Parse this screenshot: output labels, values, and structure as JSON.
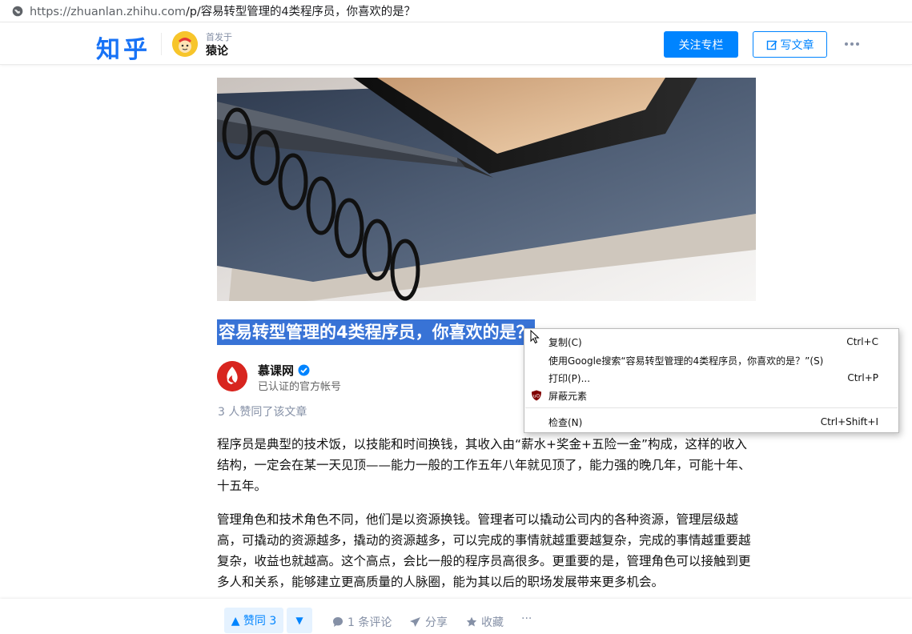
{
  "browser": {
    "url_host": "https://zhuanlan.zhihu.com",
    "url_path": "/p/容易转型管理的4类程序员，你喜欢的是？"
  },
  "header": {
    "logo": "知乎",
    "published_in": "首发于",
    "column_name": "猿论",
    "follow_label": "关注专栏",
    "write_label": "写文章"
  },
  "article": {
    "title": "容易转型管理的4类程序员，你喜欢的是？",
    "author_name": "慕课网",
    "author_desc": "已认证的官方帐号",
    "agree_summary": "3 人赞同了该文章",
    "paragraphs": [
      "程序员是典型的技术饭，以技能和时间换钱，其收入由“薪水+奖金+五险一金”构成，这样的收入结构，一定会在某一天见顶——能力一般的工作五年八年就见顶了，能力强的晚几年，可能十年、十五年。",
      "管理角色和技术角色不同，他们是以资源换钱。管理者可以撬动公司内的各种资源，管理层级越高，可撬动的资源越多，撬动的资源越多，可以完成的事情就越重要越复杂，完成的事情越重要越复杂，收益也就越高。这个高点，会比一般的程序员高很多。更重要的是，管理角色可以接触到更多人和关系，能够建立更高质量的人脉圈，能为其以后的职场发展带来更多机会。"
    ]
  },
  "actions": {
    "vote_up": "▲ 赞同 3",
    "vote_down": "▼",
    "comment": "1 条评论",
    "share": "分享",
    "favorite": "收藏",
    "more": "···"
  },
  "context_menu": {
    "items": [
      {
        "label": "复制(C)",
        "shortcut": "Ctrl+C"
      },
      {
        "label": "使用Google搜索“容易转型管理的4类程序员，你喜欢的是？”(S)",
        "shortcut": ""
      },
      {
        "label": "打印(P)...",
        "shortcut": "Ctrl+P"
      },
      {
        "label": "屏蔽元素",
        "shortcut": ""
      },
      {
        "label": "检查(N)",
        "shortcut": "Ctrl+Shift+I"
      }
    ]
  },
  "colors": {
    "brand": "#1772F6",
    "primary_button": "#0084ff",
    "selection": "#3873d6",
    "muted": "#8590a6"
  },
  "icons": [
    "globe-icon",
    "column-avatar",
    "edit-icon",
    "more-icon",
    "verified-icon",
    "comment-icon",
    "share-icon",
    "star-icon",
    "ublock-icon"
  ]
}
